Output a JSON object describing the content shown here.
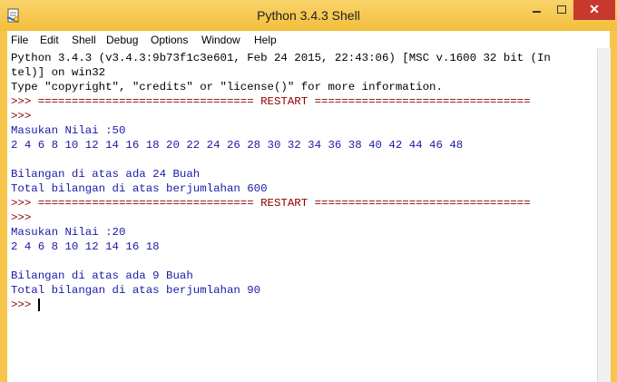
{
  "window": {
    "title": "Python 3.4.3 Shell"
  },
  "menu": [
    "File",
    "Edit",
    "Shell",
    "Debug",
    "Options",
    "Window",
    "Help"
  ],
  "shell": {
    "lines": [
      {
        "text": "Python 3.4.3 (v3.4.3:9b73f1c3e601, Feb 24 2015, 22:43:06) [MSC v.1600 32 bit (In",
        "style": "out"
      },
      {
        "text": "tel)] on win32",
        "style": "out"
      },
      {
        "text": "Type \"copyright\", \"credits\" or \"license()\" for more information.",
        "style": "out"
      },
      {
        "text": ">>> ================================ RESTART ================================",
        "style": "prompt"
      },
      {
        "text": ">>> ",
        "style": "prompt"
      },
      {
        "text": "Masukan Nilai :50",
        "style": "blue"
      },
      {
        "text": "2 4 6 8 10 12 14 16 18 20 22 24 26 28 30 32 34 36 38 40 42 44 46 48",
        "style": "blue"
      },
      {
        "text": "",
        "style": "blue"
      },
      {
        "text": "Bilangan di atas ada 24 Buah",
        "style": "blue"
      },
      {
        "text": "Total bilangan di atas berjumlahan 600",
        "style": "blue"
      },
      {
        "text": ">>> ================================ RESTART ================================",
        "style": "prompt"
      },
      {
        "text": ">>> ",
        "style": "prompt"
      },
      {
        "text": "Masukan Nilai :20",
        "style": "blue"
      },
      {
        "text": "2 4 6 8 10 12 14 16 18",
        "style": "blue"
      },
      {
        "text": "",
        "style": "blue"
      },
      {
        "text": "Bilangan di atas ada 9 Buah",
        "style": "blue"
      },
      {
        "text": "Total bilangan di atas berjumlahan 90",
        "style": "blue"
      },
      {
        "text": ">>> ",
        "style": "prompt"
      }
    ]
  }
}
